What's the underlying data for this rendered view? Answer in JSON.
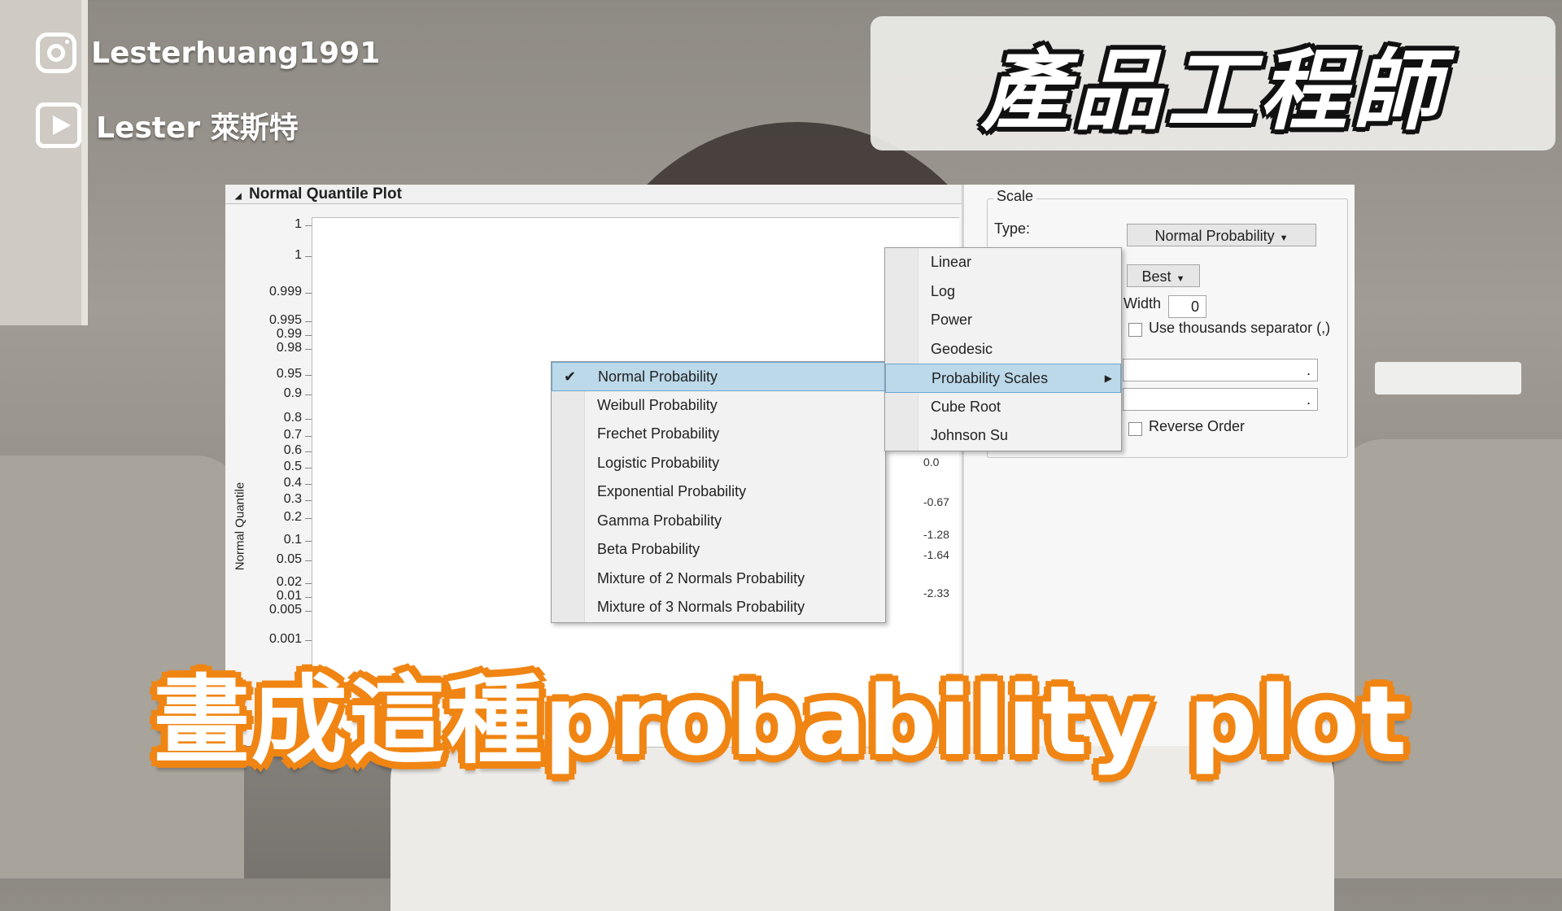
{
  "overlay": {
    "instagram": {
      "icon": "instagram-icon",
      "handle": "Lesterhuang1991"
    },
    "youtube": {
      "icon": "youtube-icon",
      "channel": "Lester 萊斯特"
    },
    "title": "產品工程師",
    "caption": "畫成這種probability plot",
    "caption_outline_color": "#f08513"
  },
  "plot": {
    "header": "Normal Quantile Plot",
    "ylabel": "Normal Quantile",
    "y_ticks": [
      "1",
      "1",
      "0.999",
      "0.995",
      "0.99",
      "0.98",
      "0.95",
      "0.9",
      "0.8",
      "0.7",
      "0.6",
      "0.5",
      "0.4",
      "0.3",
      "0.2",
      "0.1",
      "0.05",
      "0.02",
      "0.01",
      "0.005",
      "0.001"
    ],
    "right_ticks": [
      "0.0",
      "-0.67",
      "-1.28",
      "-1.64",
      "-2.33"
    ]
  },
  "probability_menu": {
    "items": [
      {
        "label": "Normal Probability",
        "checked": true
      },
      {
        "label": "Weibull Probability",
        "checked": false
      },
      {
        "label": "Frechet Probability",
        "checked": false
      },
      {
        "label": "Logistic Probability",
        "checked": false
      },
      {
        "label": "Exponential Probability",
        "checked": false
      },
      {
        "label": "Gamma Probability",
        "checked": false
      },
      {
        "label": "Beta Probability",
        "checked": false
      },
      {
        "label": "Mixture of 2 Normals Probability",
        "checked": false
      },
      {
        "label": "Mixture of 3 Normals Probability",
        "checked": false
      }
    ]
  },
  "type_menu": {
    "items": [
      "Linear",
      "Log",
      "Power",
      "Geodesic",
      "Probability Scales",
      "Cube Root",
      "Johnson Su"
    ],
    "highlighted": "Probability Scales"
  },
  "scale_panel": {
    "group_title": "Scale",
    "type_label": "Type:",
    "type_value": "Normal Probability",
    "format_value": "Best",
    "width_label": "Width",
    "width_value": "0",
    "thousands_label": "Use thousands separator (,)",
    "min_value": ".",
    "max_value": ".",
    "reverse_label": "Reverse Order"
  }
}
